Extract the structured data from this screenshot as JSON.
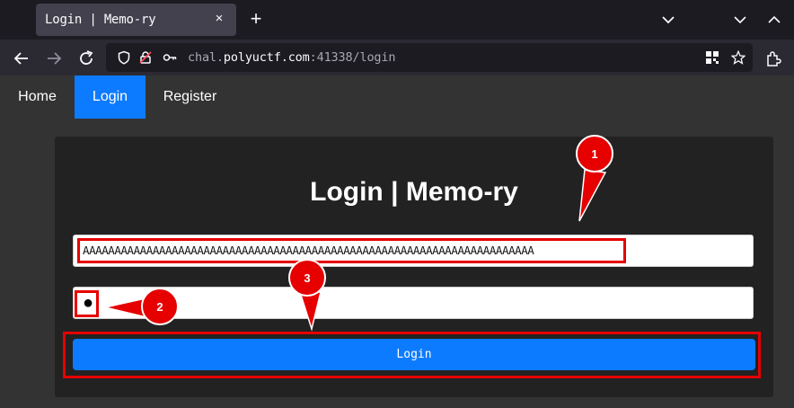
{
  "browser": {
    "tab_title": "Login | Memo-ry",
    "tab_close": "×",
    "new_tab": "+",
    "url_domain_prefix": "chal.",
    "url_domain": "polyuctf.com",
    "url_rest": ":41338/login"
  },
  "site_nav": {
    "items": [
      {
        "label": "Home",
        "active": false
      },
      {
        "label": "Login",
        "active": true
      },
      {
        "label": "Register",
        "active": false
      }
    ]
  },
  "login_form": {
    "title": "Login | Memo-ry",
    "username_value": "AAAAAAAAAAAAAAAAAAAAAAAAAAAAAAAAAAAAAAAAAAAAAAAAAAAAAAAAAAAAAAAAAAAAAAA",
    "password_mask": "●",
    "submit_label": "Login"
  },
  "annotations": {
    "color": "#e60000",
    "markers": [
      "1",
      "2",
      "3"
    ]
  }
}
